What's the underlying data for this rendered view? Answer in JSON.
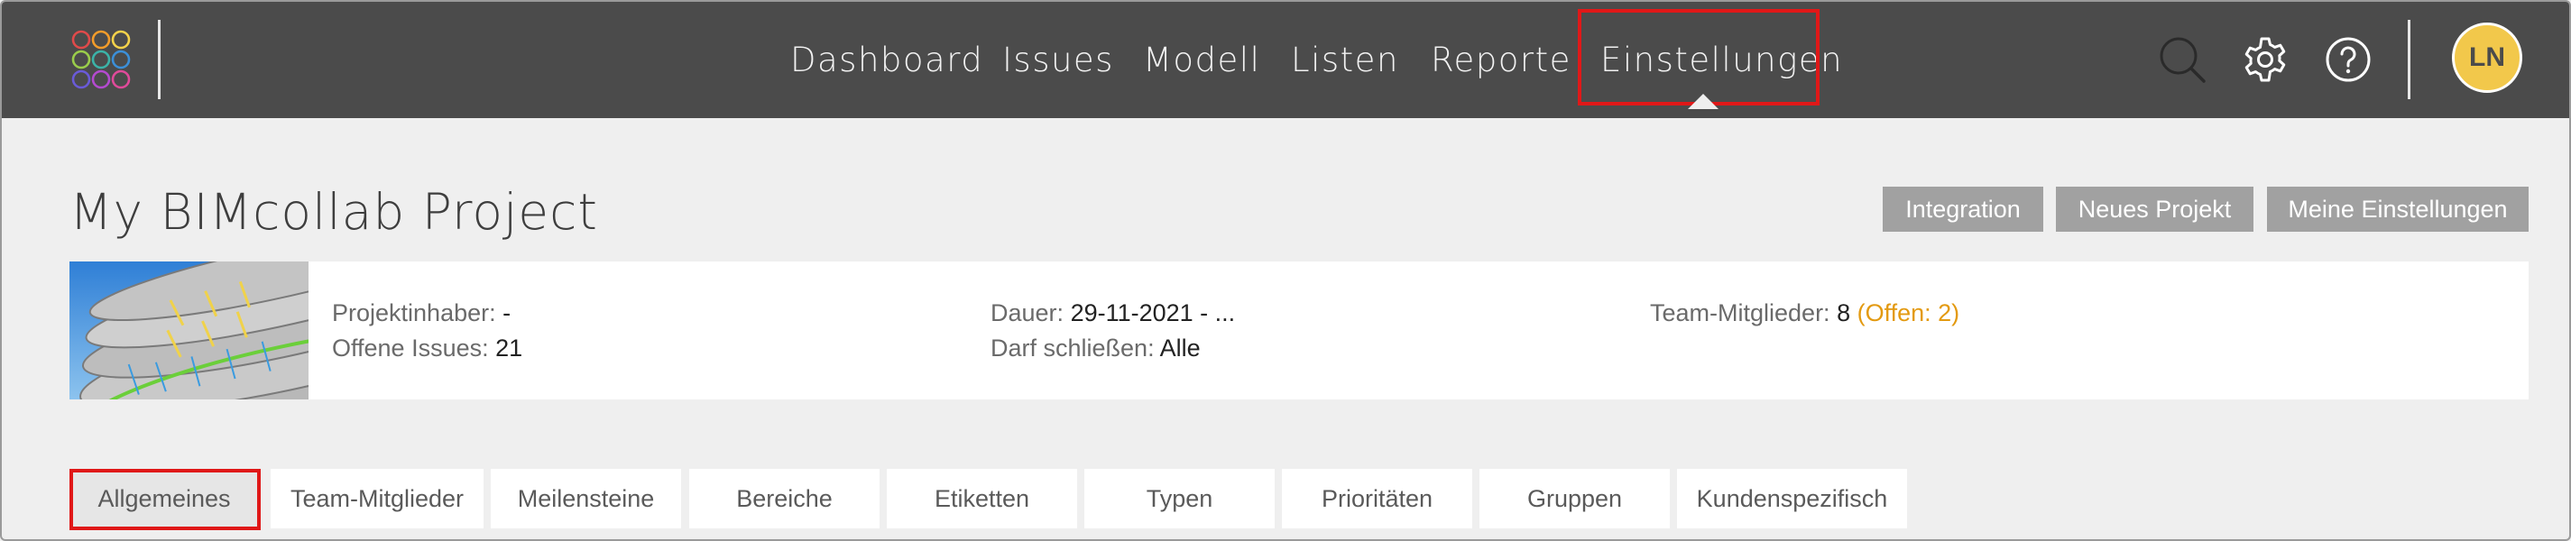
{
  "topbar": {
    "nav": [
      {
        "label": "Dashboard"
      },
      {
        "label": "Issues"
      },
      {
        "label": "Modell"
      },
      {
        "label": "Listen"
      },
      {
        "label": "Reporte"
      },
      {
        "label": "Einstellungen",
        "active": true
      }
    ],
    "icons": [
      "search-icon",
      "gear-icon",
      "help-icon"
    ],
    "avatar_initials": "LN",
    "avatar_color": "#f2c84b"
  },
  "project": {
    "title": "My BIMcollab Project",
    "actions": [
      {
        "label": "Integration"
      },
      {
        "label": "Neues Projekt"
      },
      {
        "label": "Meine Einstellungen"
      }
    ],
    "info": {
      "owner_label": "Projektinhaber:",
      "owner_value": "-",
      "open_issues_label": "Offene Issues:",
      "open_issues_value": "21",
      "duration_label": "Dauer:",
      "duration_value": "29-11-2021 - ...",
      "may_close_label": "Darf schließen:",
      "may_close_value": "Alle",
      "team_label": "Team-Mitglieder:",
      "team_value": "8",
      "team_open": "(Offen: 2)"
    }
  },
  "tabs": [
    {
      "label": "Allgemeines",
      "active": true
    },
    {
      "label": "Team-Mitglieder"
    },
    {
      "label": "Meilensteine"
    },
    {
      "label": "Bereiche"
    },
    {
      "label": "Etiketten"
    },
    {
      "label": "Typen"
    },
    {
      "label": "Prioritäten"
    },
    {
      "label": "Gruppen"
    },
    {
      "label": "Kundenspezifisch"
    }
  ],
  "colors": {
    "topbar": "#4b4b4b",
    "highlight": "#e01818",
    "button": "#a1a1a1",
    "open_count": "#e39a11"
  }
}
